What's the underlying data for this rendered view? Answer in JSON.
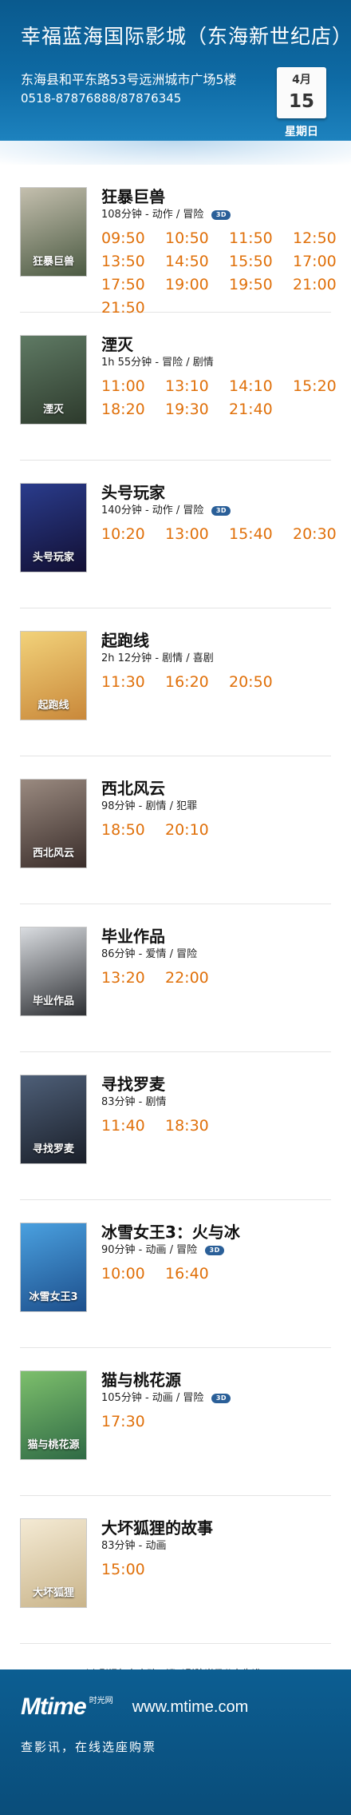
{
  "header": {
    "cinema_name": "幸福蓝海国际影城（东海新世纪店）",
    "address": "东海县和平东路53号远洲城市广场5楼",
    "phone": "0518-87876888/87876345",
    "month": "4月",
    "day": "15",
    "weekday": "星期日"
  },
  "movies": [
    {
      "title": "狂暴巨兽",
      "meta": "108分钟 - 动作 / 冒险",
      "is_3d": true,
      "badge": "3D",
      "poster_title": "狂暴巨兽",
      "poster_colors": [
        "#c4bfae",
        "#4b5a42"
      ],
      "times": [
        "09:50",
        "10:50",
        "11:50",
        "12:50",
        "13:50",
        "14:50",
        "15:50",
        "17:00",
        "17:50",
        "19:00",
        "19:50",
        "21:00",
        "21:50"
      ]
    },
    {
      "title": "湮灭",
      "meta": "1h 55分钟 - 冒险 / 剧情",
      "is_3d": false,
      "poster_title": "湮灭",
      "poster_colors": [
        "#5f7a64",
        "#2d3a2c"
      ],
      "times": [
        "11:00",
        "13:10",
        "14:10",
        "15:20",
        "18:20",
        "19:30",
        "21:40"
      ]
    },
    {
      "title": "头号玩家",
      "meta": "140分钟 - 动作 / 冒险",
      "is_3d": true,
      "badge": "3D",
      "poster_title": "头号玩家",
      "poster_colors": [
        "#2a3c8c",
        "#120f33"
      ],
      "times": [
        "10:20",
        "13:00",
        "15:40",
        "20:30"
      ]
    },
    {
      "title": "起跑线",
      "meta": "2h 12分钟 - 剧情 / 喜剧",
      "is_3d": false,
      "poster_title": "起跑线",
      "poster_colors": [
        "#f2d27a",
        "#c9883a"
      ],
      "times": [
        "11:30",
        "16:20",
        "20:50"
      ]
    },
    {
      "title": "西北风云",
      "meta": "98分钟 - 剧情 / 犯罪",
      "is_3d": false,
      "poster_title": "西北风云",
      "poster_colors": [
        "#9a8a80",
        "#3a2d2a"
      ],
      "times": [
        "18:50",
        "20:10"
      ]
    },
    {
      "title": "毕业作品",
      "meta": "86分钟 - 爱情 / 冒险",
      "is_3d": false,
      "poster_title": "毕业作品",
      "poster_colors": [
        "#d9dce0",
        "#2d2f33"
      ],
      "times": [
        "13:20",
        "22:00"
      ]
    },
    {
      "title": "寻找罗麦",
      "meta": "83分钟 - 剧情",
      "is_3d": false,
      "poster_title": "寻找罗麦",
      "poster_colors": [
        "#4e5f78",
        "#1a1f29"
      ],
      "times": [
        "11:40",
        "18:30"
      ]
    },
    {
      "title": "冰雪女王3：火与冰",
      "meta": "90分钟 - 动画 / 冒险",
      "is_3d": true,
      "badge": "3D",
      "poster_title": "冰雪女王3",
      "poster_colors": [
        "#4aa0df",
        "#1d4f8c"
      ],
      "times": [
        "10:00",
        "16:40"
      ]
    },
    {
      "title": "猫与桃花源",
      "meta": "105分钟 - 动画 / 冒险",
      "is_3d": true,
      "badge": "3D",
      "poster_title": "猫与桃花源",
      "poster_colors": [
        "#7dbf6c",
        "#2f6a45"
      ],
      "times": [
        "17:30"
      ]
    },
    {
      "title": "大坏狐狸的故事",
      "meta": "83分钟 - 动画",
      "is_3d": false,
      "poster_title": "大坏狐狸",
      "poster_colors": [
        "#f4ead4",
        "#c9b48a"
      ],
      "times": [
        "15:00"
      ]
    }
  ],
  "notice": "以上影讯如有变动，请以影院当日公布为准。",
  "footer": {
    "logo": "Mtime",
    "logo_sub": "时光网",
    "site": "www.mtime.com",
    "slogan": "查影讯，在线选座购票"
  }
}
